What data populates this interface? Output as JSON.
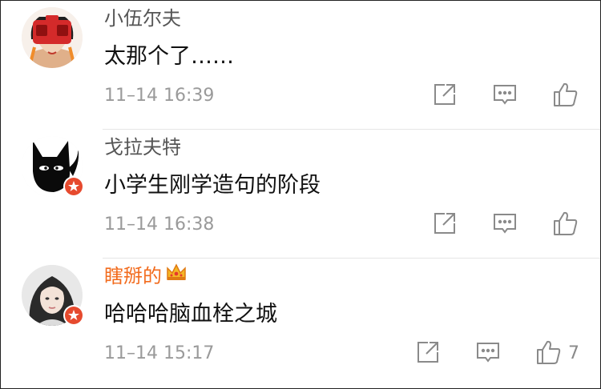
{
  "comments": [
    {
      "user": "小伍尔夫",
      "text": "太那个了……",
      "time": "11–14 16:39",
      "likes": "",
      "verified": false,
      "name_color": "#555555"
    },
    {
      "user": "戈拉夫特",
      "text": "小学生刚学造句的阶段",
      "time": "11–14 16:38",
      "likes": "",
      "verified": true,
      "name_color": "#555555"
    },
    {
      "user": "瞎掰的",
      "text": "哈哈哈脑血栓之城",
      "time": "11–14 15:17",
      "likes": "7",
      "verified": true,
      "name_color": "#f26b1d"
    }
  ],
  "colors": {
    "accent_orange": "#f26b1d",
    "badge_red": "#e64a2e",
    "icon_gray": "#8a8a8a",
    "timestamp": "#9a9a9a"
  },
  "icons": [
    "share-icon",
    "comment-icon",
    "like-icon",
    "crown-icon",
    "verified-badge-icon"
  ]
}
